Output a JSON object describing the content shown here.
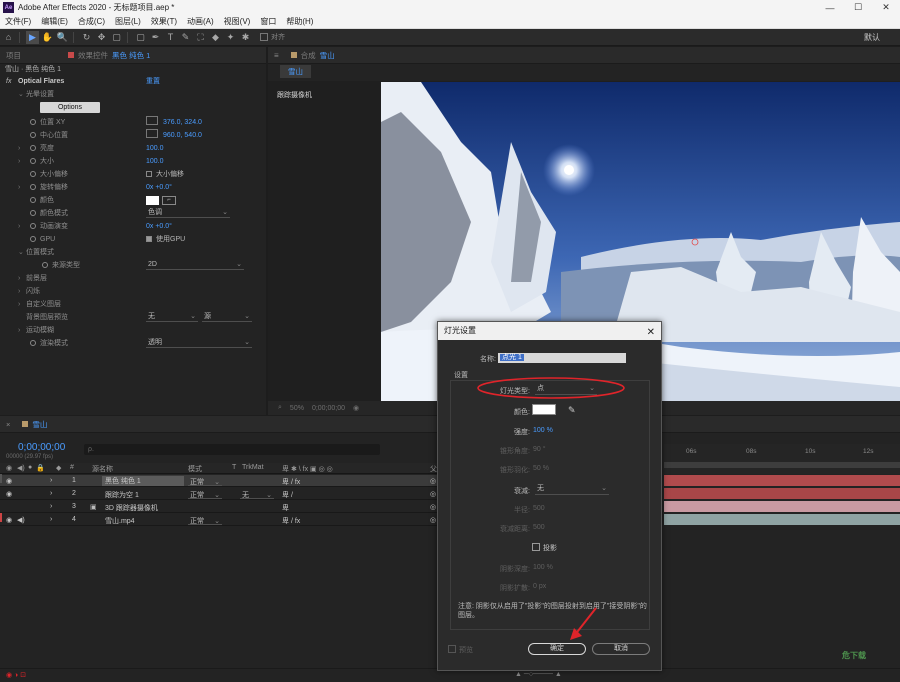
{
  "app": {
    "title": "Adobe After Effects 2020 - 无标题项目.aep *",
    "logo_text": "Ae",
    "window_controls": [
      "—",
      "☐",
      "✕"
    ]
  },
  "menu": [
    "文件(F)",
    "编辑(E)",
    "合成(C)",
    "图层(L)",
    "效果(T)",
    "动画(A)",
    "视图(V)",
    "窗口",
    "帮助(H)"
  ],
  "toolbar": {
    "tools": [
      "▶",
      "✋",
      "🔍",
      "↻",
      "✥",
      "▢",
      "✒",
      "T",
      "✎",
      "⛶",
      "◆",
      "✦",
      "✱"
    ],
    "align_label": "对齐",
    "workspace_label": "默认"
  },
  "effects_panel": {
    "project_tab": "项目",
    "fx_tab_prefix": "效果控件",
    "fx_tab_target": "黑色 纯色 1",
    "layer_path": "雪山 · 黑色 纯色 1",
    "effect_name": "Optical Flares",
    "reset": "重置",
    "flare_settings": "光晕设置",
    "options_button": "Options",
    "rows": {
      "position_xy": "位置 XY",
      "position_xy_val": "376.0, 324.0",
      "center_pos": "中心位置",
      "center_pos_val": "960.0, 540.0",
      "brightness": "亮度",
      "brightness_val": "100.0",
      "size": "大小",
      "size_val": "100.0",
      "size_offset": "大小偏移",
      "size_offset_check": "大小偏移",
      "rotation_offset": "旋转偏移",
      "rotation_offset_val": "0x +0.0°",
      "color": "颜色",
      "color_mode": "颜色模式",
      "color_mode_val": "色调",
      "anim_evolution": "动画演变",
      "anim_evolution_val": "0x +0.0°",
      "gpu": "GPU",
      "gpu_check": "使用GPU",
      "position_mode": "位置模式",
      "source_type": "来源类型",
      "source_type_val": "2D",
      "foreground_layers": "前景层",
      "flicker": "闪烁",
      "custom_layer": "自定义图层",
      "bg_layer_preview": "背景图层预览",
      "bg_layer_preview_val1": "无",
      "bg_layer_preview_val2": "源",
      "motion_blur": "运动模糊",
      "render_mode": "渲染模式",
      "render_mode_val": "透明"
    }
  },
  "comp_panel": {
    "tab_prefix": "合成",
    "tab_name": "雪山",
    "subtab": "雪山",
    "camera_label": "跟踪摄像机",
    "zoom": "50%",
    "timecode": "0;00;00;00"
  },
  "timeline": {
    "tab": "雪山",
    "timecode": "0;00;00;00",
    "frames": "00000 (29.97 fps)",
    "search_placeholder": "ρ.",
    "headers": {
      "index": "#",
      "source_name": "源名称",
      "mode": "模式",
      "t": "T",
      "trkmat": "TrkMat",
      "parent": "父"
    },
    "layers": [
      {
        "index": "1",
        "name": "黑色 纯色 1",
        "mode": "正常",
        "trkmat": "",
        "color": "#c84a4a",
        "thumb": "#000000"
      },
      {
        "index": "2",
        "name": "跟踪为空 1",
        "mode": "正常",
        "trkmat": "无",
        "color": "#c84a4a",
        "thumb": "#7fd34b"
      },
      {
        "index": "3",
        "name": "3D 跟踪器摄像机",
        "mode": "",
        "trkmat": "",
        "color": "#e3a8b6",
        "thumb": ""
      },
      {
        "index": "4",
        "name": "雪山.mp4",
        "mode": "正常",
        "trkmat": "",
        "color": "#b9d3d3",
        "thumb": "#ffffff"
      }
    ],
    "ruler_ticks": [
      "06s",
      "08s",
      "10s",
      "12s"
    ],
    "track_colors": [
      "#b14b4d",
      "#b14b4d",
      "#c99aa2",
      "#8fa3a3"
    ]
  },
  "dialog": {
    "title": "灯光设置",
    "close": "✕",
    "name_label": "名称:",
    "name_value": "点光 1",
    "group_label": "设置",
    "light_type_label": "灯光类型:",
    "light_type_value": "点",
    "color_label": "颜色:",
    "intensity_label": "强度:",
    "intensity_value": "100 %",
    "cone_angle_label": "锥形角度:",
    "cone_angle_value": "90 °",
    "cone_feather_label": "锥形羽化:",
    "cone_feather_value": "50 %",
    "falloff_label": "衰减:",
    "falloff_value": "无",
    "radius_label": "半径:",
    "radius_value": "500",
    "falloff_distance_label": "衰减距离:",
    "falloff_distance_value": "500",
    "cast_shadows_label": "投影",
    "shadow_darkness_label": "阴影深度:",
    "shadow_darkness_value": "100 %",
    "shadow_diffusion_label": "阴影扩散:",
    "shadow_diffusion_value": "0 px",
    "note": "注意: 阴影仅从启用了\"投影\"的图层投射到启用了\"接受阴影\"的图层。",
    "preview_label": "预览",
    "ok_label": "确定",
    "cancel_label": "取消",
    "light_color": "#ffffff"
  },
  "watermark": "危下载",
  "accent_color": "#4a9cff",
  "highlight_color": "#e0242a"
}
